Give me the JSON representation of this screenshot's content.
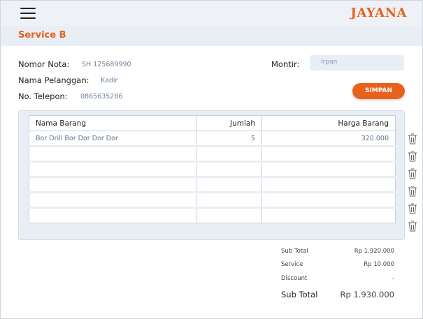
{
  "header": {
    "brand": "JAYANA"
  },
  "section": {
    "title": "Service B"
  },
  "info": {
    "nomor_nota_label": "Nomor Nota:",
    "nomor_nota_value": "SH 125689990",
    "nama_pelanggan_label": "Nama Pelanggan:",
    "nama_pelanggan_value": "Kadir",
    "no_telepon_label": "No. Telepon:",
    "no_telepon_value": "0865635286",
    "montir_label": "Montir:",
    "montir_value": "Irpan"
  },
  "actions": {
    "simpan_label": "SIMPAN"
  },
  "table": {
    "headers": [
      "Nama Barang",
      "Jumlah",
      "Harga Barang"
    ],
    "rows": [
      [
        "Bor Drill Bor Dor Dor Dor",
        "5",
        "320.000"
      ],
      [
        "",
        "",
        ""
      ],
      [
        "",
        "",
        ""
      ],
      [
        "",
        "",
        ""
      ],
      [
        "",
        "",
        ""
      ],
      [
        "",
        "",
        ""
      ]
    ]
  },
  "totals": {
    "sub_total_label": "Sub Total",
    "sub_total_value": "Rp 1.920.000",
    "service_label": "Service",
    "service_value": "Rp 10.000",
    "discount_label": "Discount",
    "discount_value": "-",
    "grand_label": "Sub Total",
    "grand_value": "Rp 1.930.000"
  },
  "colors": {
    "accent": "#e8621c",
    "header_bg": "#eef2f7",
    "value_text": "#6e8195"
  },
  "icons": [
    "menu-icon",
    "trash-icon"
  ]
}
